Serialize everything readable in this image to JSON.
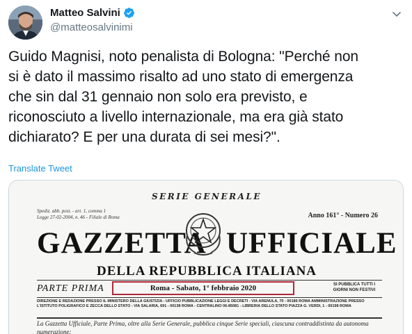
{
  "author": {
    "display_name": "Matteo Salvini",
    "handle": "@matteosalvinimi",
    "verified": true
  },
  "icons": {
    "verified": "verified-badge-icon",
    "menu": "chevron-down-icon"
  },
  "tweet": {
    "text": "Guido Magnisi, noto penalista di Bologna: \"Perché non\nsi è dato il massimo risalto ad uno stato di emergenza\nche sin dal 31 gennaio non solo era previsto, e\nriconosciuto a livello internazionale, ma era già stato\ndichiarato? E per una durata di sei mesi?\".",
    "translate_label": "Translate Tweet"
  },
  "media": {
    "serie": "SERIE GENERALE",
    "spedizione": "Spediz. abb. post. - art. 1, comma 1\nLegge 27-02-2004, n. 46 - Filiale di Roma",
    "anno": "Anno 161° - Numero 26",
    "title_left": "GAZZETTA",
    "title_right": "UFFICIALE",
    "subtitle": "DELLA REPUBBLICA ITALIANA",
    "parte": "PARTE PRIMA",
    "date_line": "Roma - Sabato, 1° febbraio 2020",
    "pubblica": "SI PUBBLICA TUTTI I GIORNI NON FESTIVI",
    "direzione": "DIREZIONE E REDAZIONE PRESSO IL MINISTERO DELLA GIUSTIZIA - UFFICIO PUBBLICAZIONE LEGGI E DECRETI - VIA ARENULA, 70 - 00186 ROMA AMMINISTRAZIONE PRESSO L'ISTITUTO POLIGRAFICO E ZECCA DELLO STATO - VIA SALARIA, 691 - 00138 ROMA - CENTRALINO 06-85081 - LIBRERIA DELLO STATO PIAZZA G. VERDI, 1 - 00198 ROMA",
    "footnote": "La Gazzetta Ufficiale, Parte Prima, oltre alla Serie Generale, pubblica cinque Serie speciali, ciascuna contraddistinta da autonoma numerazione:"
  },
  "colors": {
    "link": "#1b95e0",
    "verified": "#1da1f2",
    "date_border": "#b0283a"
  }
}
